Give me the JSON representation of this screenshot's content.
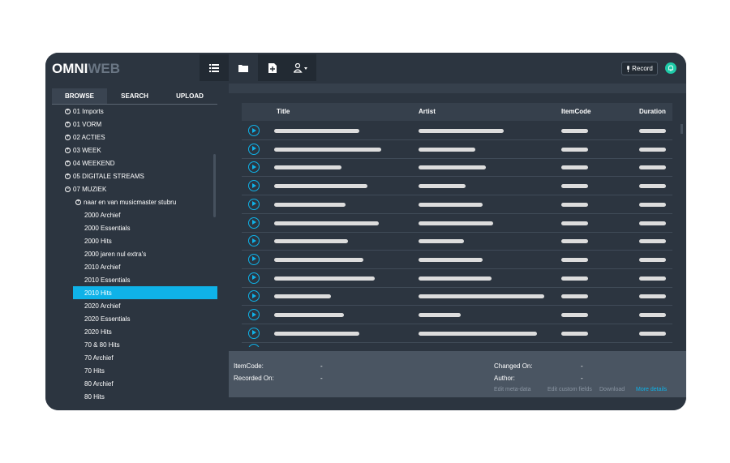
{
  "app": {
    "logo_part1": "OMNI",
    "logo_part2": "WEB",
    "record_label": "Record"
  },
  "toolbar": {
    "icons": [
      "list-icon",
      "folder-icon",
      "file-plus-icon",
      "user-dropdown-icon"
    ]
  },
  "sidebar": {
    "tabs": [
      "BROWSE",
      "SEARCH",
      "UPLOAD"
    ],
    "active_tab": "BROWSE",
    "tree": [
      {
        "label": "01 Imports",
        "level": 0,
        "expander": "+"
      },
      {
        "label": "01 VORM",
        "level": 0,
        "expander": "+"
      },
      {
        "label": "02 ACTIES",
        "level": 0,
        "expander": "+"
      },
      {
        "label": "03 WEEK",
        "level": 0,
        "expander": "+"
      },
      {
        "label": "04 WEEKEND",
        "level": 0,
        "expander": "+"
      },
      {
        "label": "05 DIGITALE STREAMS",
        "level": 0,
        "expander": "+"
      },
      {
        "label": "07 MUZIEK",
        "level": 0,
        "expander": "−"
      },
      {
        "label": "naar en van musicmaster stubru",
        "level": 1,
        "expander": "+"
      },
      {
        "label": "2000 Archief",
        "level": 2,
        "expander": ""
      },
      {
        "label": "2000 Essentials",
        "level": 2,
        "expander": ""
      },
      {
        "label": "2000 Hits",
        "level": 2,
        "expander": ""
      },
      {
        "label": "2000 jaren nul extra's",
        "level": 2,
        "expander": ""
      },
      {
        "label": "2010 Archief",
        "level": 2,
        "expander": ""
      },
      {
        "label": "2010 Essentials",
        "level": 2,
        "expander": ""
      },
      {
        "label": "2010 Hits",
        "level": 2,
        "expander": "",
        "selected": true
      },
      {
        "label": "2020 Archief",
        "level": 2,
        "expander": ""
      },
      {
        "label": "2020 Essentials",
        "level": 2,
        "expander": ""
      },
      {
        "label": "2020 Hits",
        "level": 2,
        "expander": ""
      },
      {
        "label": "70 & 80 Hits",
        "level": 2,
        "expander": ""
      },
      {
        "label": "70 Archief",
        "level": 2,
        "expander": ""
      },
      {
        "label": "70 Hits",
        "level": 2,
        "expander": ""
      },
      {
        "label": "80 Archief",
        "level": 2,
        "expander": ""
      },
      {
        "label": "80 Hits",
        "level": 2,
        "expander": ""
      }
    ]
  },
  "table": {
    "columns": [
      "Title",
      "Artist",
      "ItemCode",
      "Duration"
    ]
  },
  "details": {
    "itemcode_label": "ItemCode:",
    "itemcode_value": "-",
    "recorded_label": "Recorded On:",
    "recorded_value": "-",
    "changed_label": "Changed On:",
    "changed_value": "-",
    "author_label": "Author:",
    "author_value": "-",
    "links": [
      "Edit meta-data",
      "Edit custom fields",
      "Download",
      "More details"
    ]
  },
  "colors": {
    "accent": "#0fb2e8",
    "background": "#2c3540",
    "notification": "#1ec9a7"
  }
}
